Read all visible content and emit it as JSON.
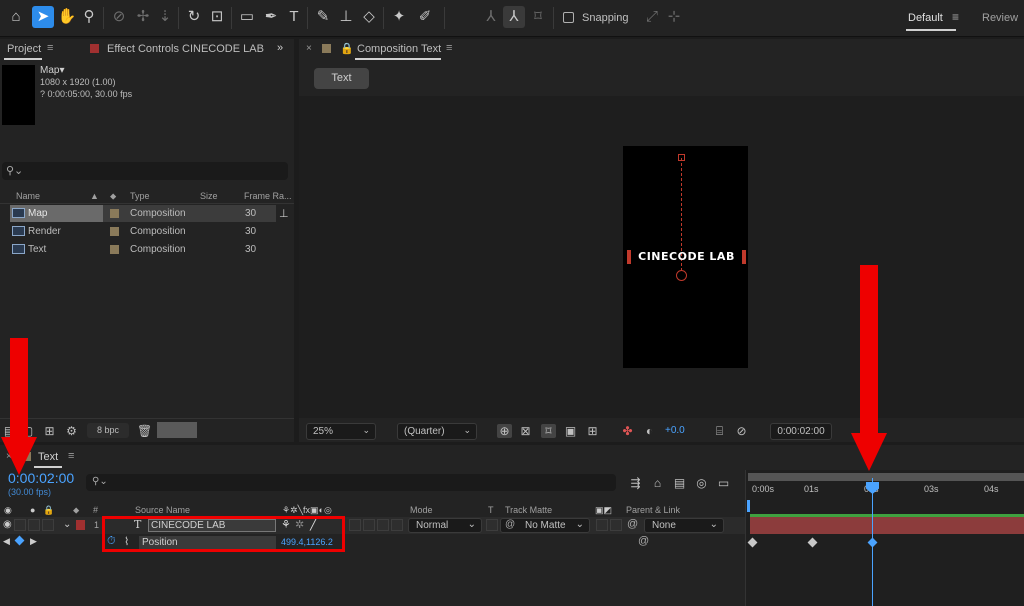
{
  "toolbar": {
    "snapping_label": "Snapping",
    "workspace_active": "Default",
    "workspace_other": "Review",
    "tools": [
      "home-icon",
      "selection-tool",
      "hand-tool",
      "zoom-tool",
      "orbit-tool",
      "pan-tool",
      "dolly-tool",
      "rotate-tool",
      "track-camera-tool",
      "rectangle-tool",
      "pen-tool",
      "type-tool",
      "brush-tool",
      "clone-stamp-tool",
      "eraser-tool",
      "roto-brush-tool",
      "puppet-pin-tool"
    ]
  },
  "project": {
    "tab_label": "Project",
    "effect_controls_label": "Effect Controls CINECODE LAB",
    "comp_name": "Map▾",
    "comp_dimensions": "1080 x 1920 (1.00)",
    "comp_duration": "? 0:00:05:00, 30.00 fps",
    "search_placeholder": "",
    "columns": [
      "Name",
      "Type",
      "Size",
      "Frame Ra..."
    ],
    "items": [
      {
        "name": "Map",
        "type": "Composition",
        "frame_rate": "30",
        "selected": true
      },
      {
        "name": "Render",
        "type": "Composition",
        "frame_rate": "30",
        "selected": false
      },
      {
        "name": "Text",
        "type": "Composition",
        "frame_rate": "30",
        "selected": false
      }
    ],
    "bpc": "8 bpc"
  },
  "composition": {
    "tab_label": "Composition Text",
    "viewer_button": "Text",
    "canvas_text": "CINECODE LAB",
    "zoom": "25%",
    "resolution": "(Quarter)",
    "exposure": "+0.0",
    "timecode": "0:00:02:00"
  },
  "timeline": {
    "tab_label": "Text",
    "timecode": "0:00:02:00",
    "fps": "(30.00 fps)",
    "headers": {
      "source_name": "Source Name",
      "mode": "Mode",
      "t": "T",
      "track_matte": "Track Matte",
      "parent_link": "Parent & Link",
      "num": "#"
    },
    "layer": {
      "index": "1",
      "name": "CINECODE LAB",
      "mode": "Normal",
      "matte": "No Matte",
      "parent": "None"
    },
    "property": {
      "name": "Position",
      "value": "499.4,1126.2"
    },
    "ruler": [
      "0:00s",
      "01s",
      "02s",
      "03s",
      "04s"
    ],
    "playhead_seconds": 2,
    "keyframes_seconds": [
      0,
      1,
      2
    ]
  },
  "colors": {
    "accent": "#4aa3ff",
    "annotation": "#e00000",
    "layer_bar": "#8c3c3c"
  }
}
